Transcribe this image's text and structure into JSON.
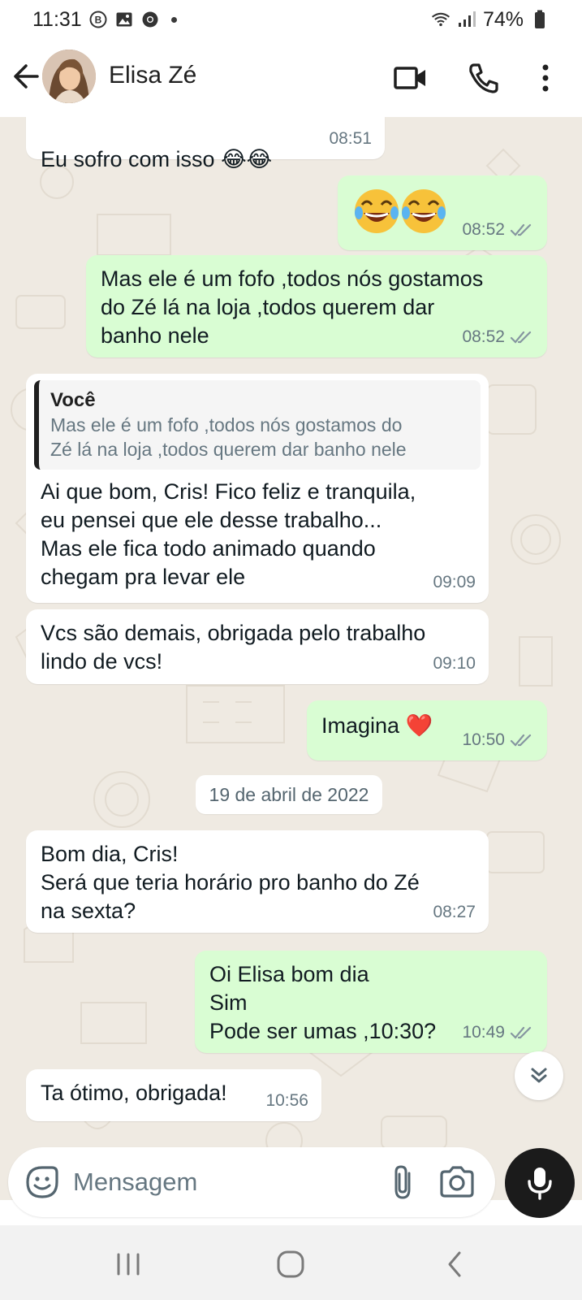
{
  "status_bar": {
    "time": "11:31",
    "battery": "74%"
  },
  "header": {
    "contact_name": "Elisa Zé"
  },
  "messages": [
    {
      "dir": "in",
      "text": "Eu sofro com isso 😂😂",
      "time": "08:51"
    },
    {
      "dir": "out",
      "text": "😂😂",
      "time": "08:52",
      "read": true
    },
    {
      "dir": "out",
      "text": "Mas ele é um fofo ,todos nós gostamos\ndo Zé lá na loja ,todos querem dar\nbanho nele",
      "time": "08:52",
      "read": true
    },
    {
      "dir": "in",
      "quote_author": "Você",
      "quote_text": "Mas ele é um fofo ,todos nós gostamos do\nZé lá na loja ,todos querem dar banho nele",
      "text": "Ai que bom, Cris! Fico feliz e tranquila,\neu pensei que ele desse trabalho...\nMas ele fica todo animado quando\nchegam pra levar ele",
      "time": "09:09"
    },
    {
      "dir": "in",
      "text": "Vcs são demais, obrigada pelo trabalho\nlindo de vcs!",
      "time": "09:10"
    },
    {
      "dir": "out",
      "text": "Imagina ❤️",
      "time": "10:50",
      "read": true
    },
    {
      "dir": "in",
      "text": "Bom dia, Cris!\nSerá que teria horário pro banho do Zé\nna sexta?",
      "time": "08:27"
    },
    {
      "dir": "out",
      "text": "Oi Elisa bom dia\nSim\nPode ser umas ,10:30?",
      "time": "10:49",
      "read": true
    },
    {
      "dir": "in",
      "text": "Ta ótimo, obrigada!",
      "time": "10:56"
    }
  ],
  "date_separator": "19 de abril de 2022",
  "input": {
    "placeholder": "Mensagem"
  },
  "colors": {
    "incoming_bubble": "#ffffff",
    "outgoing_bubble": "#d9fdd3",
    "chat_background": "#efeae2",
    "read_ticks": "#8696a0",
    "mic_button": "#1b1b1b"
  },
  "icons": [
    "back-arrow-icon",
    "video-call-icon",
    "phone-icon",
    "more-vert-icon",
    "emoji-icon",
    "attach-icon",
    "camera-icon",
    "mic-icon",
    "double-chevron-down-icon",
    "nav-recent-icon",
    "nav-home-icon",
    "nav-back-icon"
  ]
}
